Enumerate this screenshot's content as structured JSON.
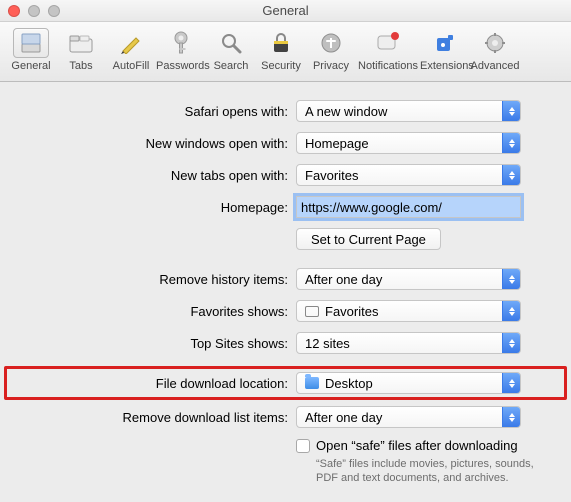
{
  "window": {
    "title": "General"
  },
  "toolbar": {
    "items": [
      {
        "label": "General",
        "icon": "general-icon"
      },
      {
        "label": "Tabs",
        "icon": "tabs-icon"
      },
      {
        "label": "AutoFill",
        "icon": "autofill-icon"
      },
      {
        "label": "Passwords",
        "icon": "passwords-icon"
      },
      {
        "label": "Search",
        "icon": "search-icon"
      },
      {
        "label": "Security",
        "icon": "security-icon"
      },
      {
        "label": "Privacy",
        "icon": "privacy-icon"
      },
      {
        "label": "Notifications",
        "icon": "notifications-icon"
      },
      {
        "label": "Extensions",
        "icon": "extensions-icon"
      },
      {
        "label": "Advanced",
        "icon": "advanced-icon"
      }
    ],
    "selected_index": 0
  },
  "form": {
    "safari_opens_with": {
      "label": "Safari opens with:",
      "value": "A new window"
    },
    "new_windows": {
      "label": "New windows open with:",
      "value": "Homepage"
    },
    "new_tabs": {
      "label": "New tabs open with:",
      "value": "Favorites"
    },
    "homepage": {
      "label": "Homepage:",
      "value": "https://www.google.com/"
    },
    "set_current_btn": "Set to Current Page",
    "remove_history": {
      "label": "Remove history items:",
      "value": "After one day"
    },
    "favorites_shows": {
      "label": "Favorites shows:",
      "value": "Favorites"
    },
    "topsites_shows": {
      "label": "Top Sites shows:",
      "value": "12 sites"
    },
    "download_location": {
      "label": "File download location:",
      "value": "Desktop"
    },
    "remove_downloads": {
      "label": "Remove download list items:",
      "value": "After one day"
    },
    "open_safe": {
      "label": "Open “safe” files after downloading",
      "note": "“Safe” files include movies, pictures, sounds, PDF and text documents, and archives.",
      "checked": false
    }
  }
}
